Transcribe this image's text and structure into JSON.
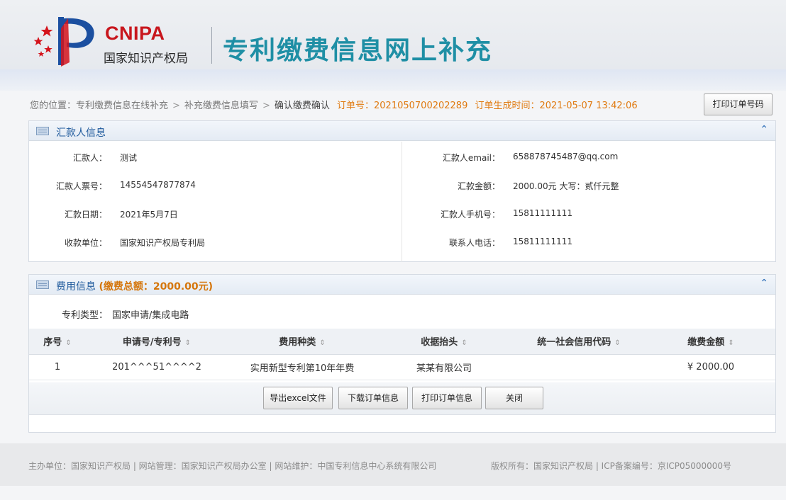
{
  "header": {
    "logo_en": "CNIPA",
    "logo_cn": "国家知识产权局",
    "site_title": "专利缴费信息网上补充"
  },
  "breadcrumb": {
    "items": [
      "您的位置：专利缴费信息在线补充",
      "补充缴费信息填写",
      "确认缴费确认"
    ],
    "order_no_label": "订单号：",
    "order_no": "2021050700202289",
    "order_time_label": "订单生成时间：",
    "order_time": "2021-05-07 13:42:06",
    "print_order_button": "打印订单号码"
  },
  "payer_panel": {
    "title": "汇款人信息",
    "left_fields": [
      {
        "label": "汇款人：",
        "value": "测试"
      },
      {
        "label": "汇款人票号：",
        "value": "14554547877874"
      },
      {
        "label": "汇款日期：",
        "value": "2021年5月7日"
      },
      {
        "label": "收款单位：",
        "value": "国家知识产权局专利局"
      }
    ],
    "right_fields": [
      {
        "label": "汇款人email：",
        "value": "658878745487@qq.com"
      },
      {
        "label": "汇款金额：",
        "value": "2000.00元 大写：贰仟元整"
      },
      {
        "label": "汇款人手机号：",
        "value": "15811111111"
      },
      {
        "label": "联系人电话：",
        "value": "15811111111"
      }
    ]
  },
  "fee_panel": {
    "title": "费用信息",
    "total_label": "(缴费总额：2000.00元)",
    "patent_type_label": "专利类型：",
    "patent_type_value": "国家申请/集成电路",
    "columns": [
      "序号",
      "申请号/专利号",
      "费用种类",
      "收据抬头",
      "统一社会信用代码",
      "缴费金额"
    ],
    "rows": [
      [
        "1",
        "201^^^51^^^^2",
        "实用新型专利第10年年费",
        "某某有限公司",
        "",
        "¥ 2000.00"
      ]
    ],
    "buttons": {
      "export": "导出excel文件",
      "download": "下载订单信息",
      "print": "打印订单信息",
      "close": "关闭"
    }
  },
  "footer": {
    "left": "主办单位：国家知识产权局 | 网站管理：国家知识产权局办公室 | 网站维护：中国专利信息中心系统有限公司",
    "right": "版权所有：国家知识产权局 | ICP备案编号：京ICP05000000号"
  }
}
